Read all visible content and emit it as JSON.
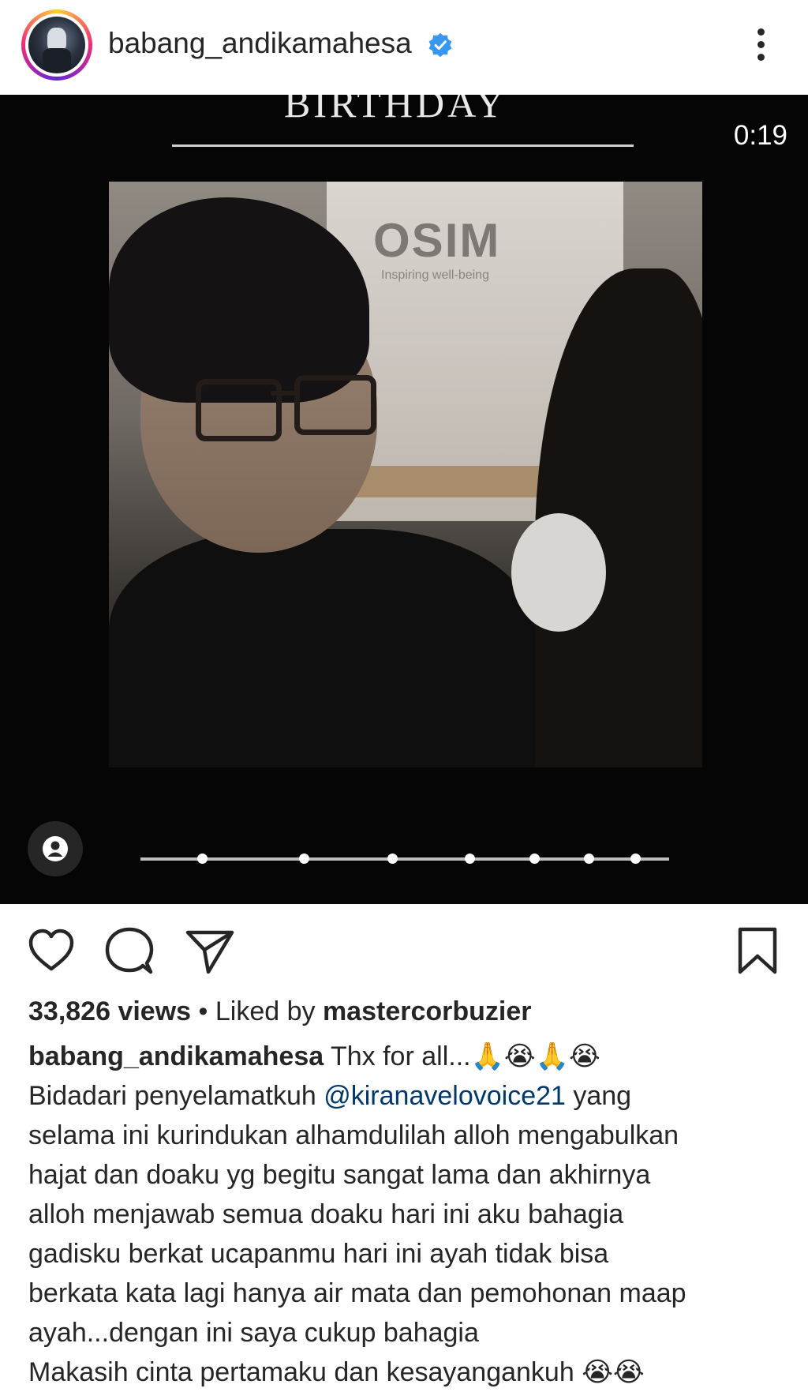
{
  "header": {
    "username": "babang_andikamahesa",
    "verified": true,
    "verified_color": "#3897f0",
    "more_icon": "more-vertical-icon",
    "avatar_ring_colors": [
      "#f9ce34",
      "#ee2a7b",
      "#6228d7"
    ]
  },
  "media": {
    "overlay_title": "BIRTHDAY",
    "timecode": "0:19",
    "sign_text": "OSIM",
    "sign_tagline": "Inspiring well-being",
    "user_tag_icon": "person-icon"
  },
  "actions": {
    "like_icon": "heart-icon",
    "comment_icon": "comment-icon",
    "share_icon": "send-icon",
    "save_icon": "bookmark-icon"
  },
  "stats": {
    "views": "33,826 views",
    "separator": " • Liked by ",
    "liked_by": "mastercorbuzier"
  },
  "caption": {
    "username": "babang_andikamahesa",
    "first": " Thx for all...🙏😭🙏😭",
    "line2_pre": "Bidadari penyelamatkuh  ",
    "mention": "@kiranavelovoice21",
    "line2_post": " yang",
    "line3": "selama ini kurindukan alhamdulilah alloh mengabulkan",
    "line4": "hajat dan doaku yg begitu sangat lama dan akhirnya",
    "line5": "alloh menjawab semua doaku hari ini aku bahagia",
    "line6": "gadisku berkat ucapanmu hari ini ayah tidak bisa",
    "line7": "berkata kata lagi hanya air mata dan pemohonan maap",
    "line8": "ayah...dengan ini saya cukup bahagia",
    "line9": "Makasih cinta pertamaku dan kesayangankuh 😭😭"
  }
}
